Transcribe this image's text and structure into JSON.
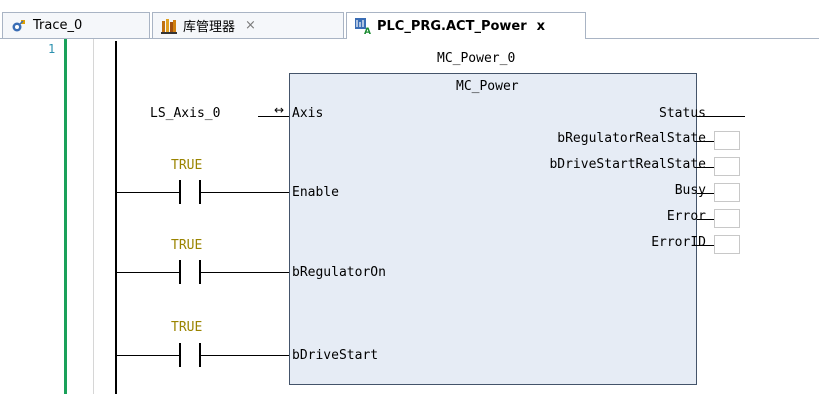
{
  "tabs": [
    {
      "label": "Trace_0",
      "icon": "trace-icon",
      "closable": false,
      "active": false
    },
    {
      "label": "库管理器",
      "icon": "library-manager-icon",
      "closable": true,
      "active": false
    },
    {
      "label": "PLC_PRG.ACT_Power",
      "icon": "ladder-action-icon",
      "closable": true,
      "active": true
    }
  ],
  "close_glyph": "×",
  "active_close_glyph": "x",
  "editor": {
    "line_number": "1",
    "instance_name": "MC_Power_0",
    "block_type": "MC_Power",
    "inputs": {
      "axis_variable": "LS_Axis_0",
      "axis": "Axis",
      "enable": "Enable",
      "regulator_on": "bRegulatorOn",
      "drive_start": "bDriveStart"
    },
    "contacts": [
      "TRUE",
      "TRUE",
      "TRUE"
    ],
    "outputs": [
      "Status",
      "bRegulatorRealState",
      "bDriveStartRealState",
      "Busy",
      "Error",
      "ErrorID"
    ],
    "reference_glyph": "↔"
  },
  "colors": {
    "gutter_line": "#1aa15a",
    "block_fill": "#e6ecf5",
    "constant_text": "#9a8400",
    "line_number": "#2b91af"
  }
}
